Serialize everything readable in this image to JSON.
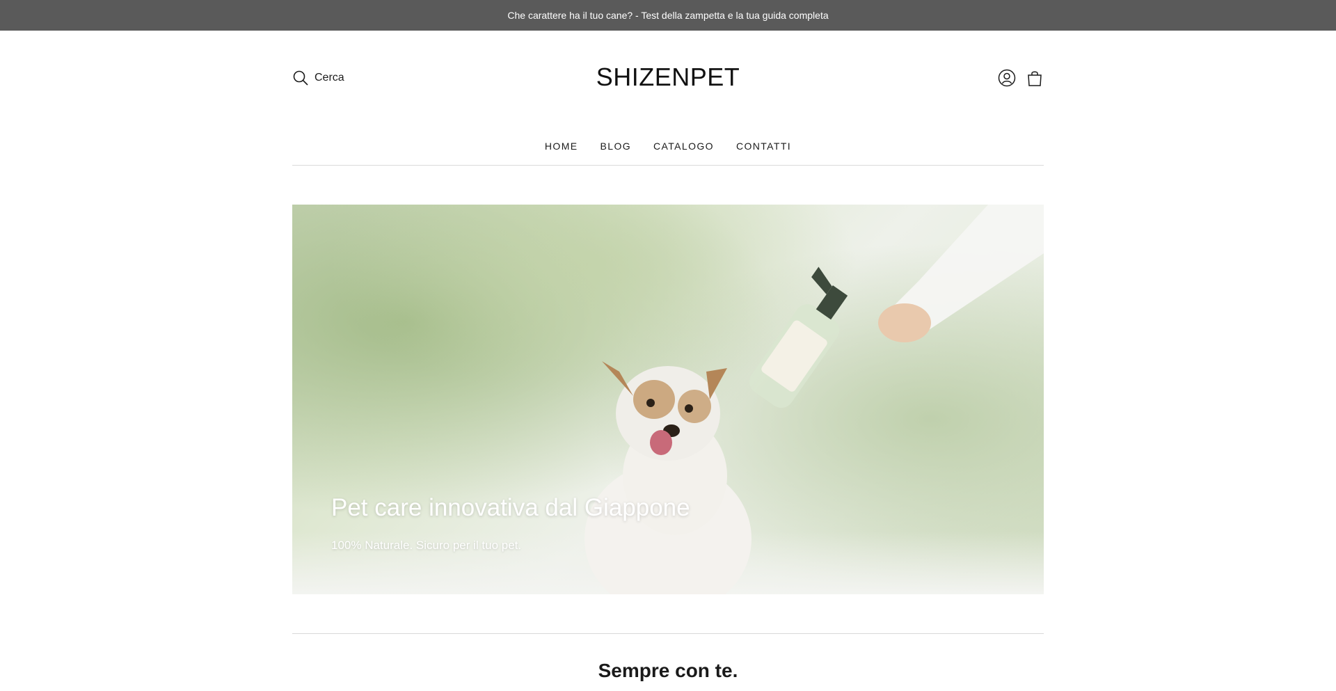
{
  "announcement": {
    "text": "Che carattere ha il tuo cane? - Test della zampetta e la tua guida completa"
  },
  "header": {
    "search_label": "Cerca",
    "logo": "SHIZENPET",
    "icons": [
      "search-icon",
      "account-icon",
      "cart-icon"
    ]
  },
  "nav": {
    "items": [
      {
        "label": "HOME"
      },
      {
        "label": "BLOG"
      },
      {
        "label": "CATALOGO"
      },
      {
        "label": "CONTATTI"
      }
    ]
  },
  "hero": {
    "title": "Pet care innovativa dal Giappone",
    "subtitle": "100% Naturale. Sicuro per il tuo pet."
  },
  "section": {
    "title": "Sempre con te."
  },
  "colors": {
    "announcement_bg": "#5a5a5a",
    "text": "#1a1a1a",
    "divider": "#d9d9d9"
  }
}
